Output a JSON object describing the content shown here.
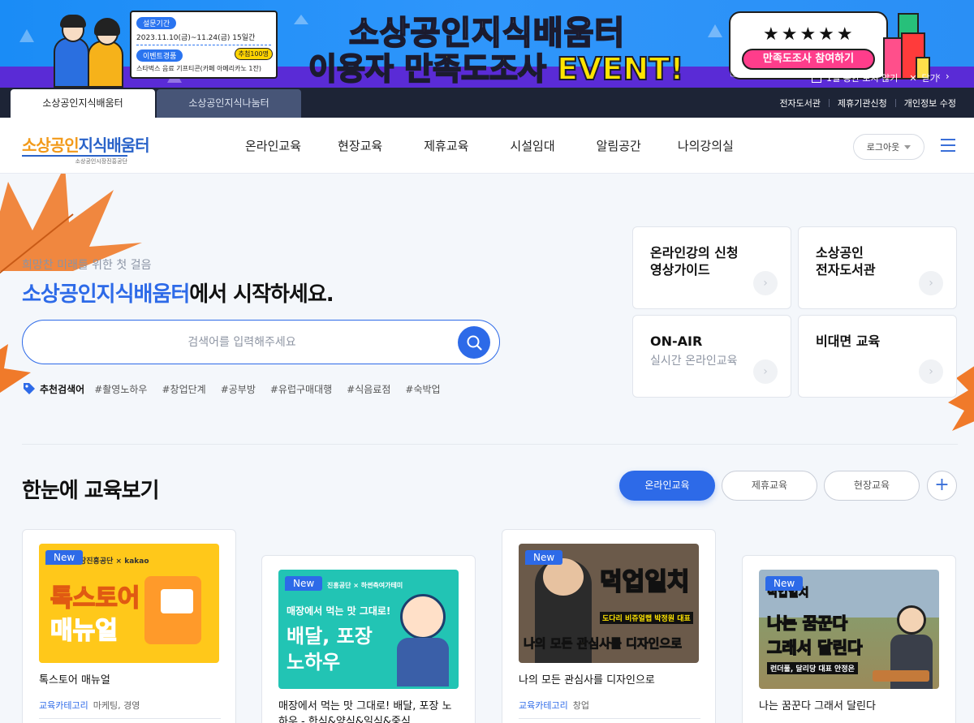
{
  "banner": {
    "period_tag": "설문기간",
    "period": "2023.11.10(금)~11.24(금) 15일간",
    "prize_tag": "이벤트경품",
    "prize": "스타벅스 음료 기프티콘(카페 아메리카노 1잔)",
    "raffle": "추첨100명",
    "title_line1": "소상공인지식배움터",
    "title_line2": "이용자 만족도조사 EVENT!",
    "stars": "★★★★★",
    "cta": "만족도조사 참여하기",
    "hide_today": "1일 동안 보지 않기",
    "close": "닫기",
    "prev": "‹",
    "next": "›"
  },
  "topbar": {
    "site_tabs": [
      "소상공인지식배움터",
      "소상공인지식나눔터"
    ],
    "links": [
      "전자도서관",
      "제휴기관신청",
      "개인정보 수정"
    ]
  },
  "header": {
    "logo_orange": "소상공인",
    "logo_blue": "지식배움터",
    "logo_sub": "소상공인시장진흥공단",
    "nav": [
      "온라인교육",
      "현장교육",
      "제휴교육",
      "시설임대",
      "알림공간",
      "나의강의실"
    ],
    "logout": "로그아웃"
  },
  "hero": {
    "subtitle": "희망찬 미래를 위한 첫 걸음",
    "title_highlight": "소상공인지식배움터",
    "title_rest": "에서 시작하세요.",
    "search_placeholder": "검색어를 입력해주세요",
    "recommend_label": "추천검색어",
    "keywords": [
      "#촬영노하우",
      "#창업단계",
      "#공부방",
      "#유럽구매대행",
      "#식음료점",
      "#숙박업"
    ],
    "quick_links": [
      {
        "title": "온라인강의 신청\n영상가이드",
        "sub": ""
      },
      {
        "title": "소상공인\n전자도서관",
        "sub": ""
      },
      {
        "title": "ON-AIR",
        "sub": "실시간 온라인교육"
      },
      {
        "title": "비대면 교육",
        "sub": ""
      }
    ]
  },
  "edu": {
    "title": "한눈에 교육보기",
    "tabs": [
      "온라인교육",
      "제휴교육",
      "현장교육"
    ],
    "active_tab": "온라인교육",
    "cards": [
      {
        "badge": "New",
        "title": "톡스토어 매뉴얼",
        "cat_label": "교육카테고리",
        "cat_value": "마케팅, 경영",
        "thumb_top": "장진흥공단 × kakao",
        "thumb_text1": "톡스토어",
        "thumb_text2": "매뉴얼"
      },
      {
        "badge": "New",
        "title": "매장에서 먹는 맛 그대로! 배달, 포장 노하우 - 한식&양식&일식&중식",
        "cat_label": "",
        "cat_value": "",
        "thumb_top": "진흥공단 × 하썬측여가테미",
        "thumb_text1": "매장에서 먹는 맛 그대로!",
        "thumb_text2": "배달, 포장",
        "thumb_text3": "노하우"
      },
      {
        "badge": "New",
        "title": "나의 모든 관심사를 디자인으로",
        "cat_label": "교육카테고리",
        "cat_value": "창업",
        "thumb_top": "덕업일치",
        "thumb_text1": "도다리 비쥬얼랩 박정원 대표",
        "thumb_text2": "나의 모든 관심사를 디자인으로"
      },
      {
        "badge": "New",
        "title": "나는 꿈꾼다 그래서 달린다",
        "cat_label": "",
        "cat_value": "",
        "thumb_top": "덕업일치",
        "thumb_text1": "나는 꿈꾼다",
        "thumb_text2": "그래서 달린다",
        "thumb_text3": "런더풀, 달리당 대표 안정은"
      }
    ]
  },
  "colors": {
    "primary": "#2d6ae8",
    "banner_blue": "#1a8cf6",
    "banner_purple": "#5a2bd6",
    "topbar": "#1d2436",
    "logo_orange": "#f29a1a",
    "cta_pink": "#ff3d8b"
  }
}
